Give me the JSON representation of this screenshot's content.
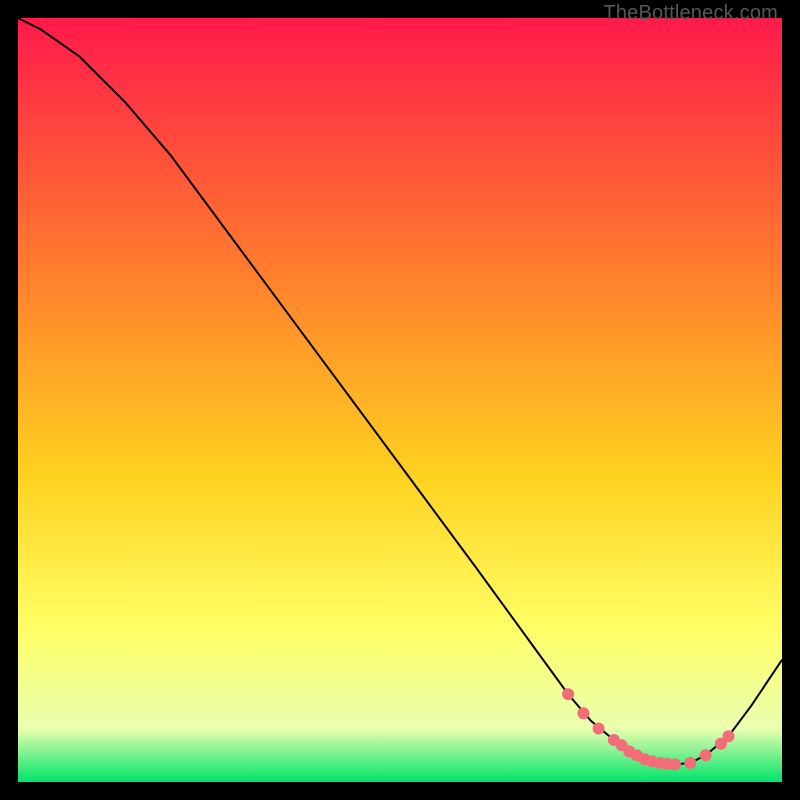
{
  "watermark": "TheBottleneck.com",
  "colors": {
    "bg": "#000000",
    "curve": "#000000",
    "marker": "#f26d78",
    "grad_top": "#ff1a4b",
    "grad_mid1": "#ff7a2e",
    "grad_mid2": "#ffd21f",
    "grad_mid3": "#ffff66",
    "grad_mid4": "#eaffb0",
    "grad_bottom": "#00e36b"
  },
  "chart_data": {
    "type": "line",
    "title": "",
    "xlabel": "",
    "ylabel": "",
    "xlim": [
      0,
      100
    ],
    "ylim": [
      0,
      100
    ],
    "series": [
      {
        "name": "curve",
        "x": [
          0,
          3,
          8,
          14,
          20,
          30,
          40,
          50,
          60,
          68,
          72,
          75,
          78,
          80,
          82,
          84,
          86,
          88,
          90,
          93,
          96,
          100
        ],
        "y": [
          100,
          98.5,
          95,
          89,
          82,
          68.5,
          55,
          41.5,
          28,
          17,
          11.5,
          8,
          5.5,
          4,
          3,
          2.5,
          2.3,
          2.5,
          3.5,
          6,
          10,
          16
        ]
      }
    ],
    "markers": {
      "name": "highlight-points",
      "x": [
        72,
        74,
        76,
        78,
        79,
        80,
        81,
        82,
        83,
        84,
        85,
        86,
        88,
        90,
        92,
        93
      ],
      "y": [
        11.5,
        9,
        7,
        5.5,
        4.8,
        4,
        3.5,
        3,
        2.7,
        2.5,
        2.4,
        2.3,
        2.5,
        3.5,
        5,
        6
      ]
    }
  }
}
